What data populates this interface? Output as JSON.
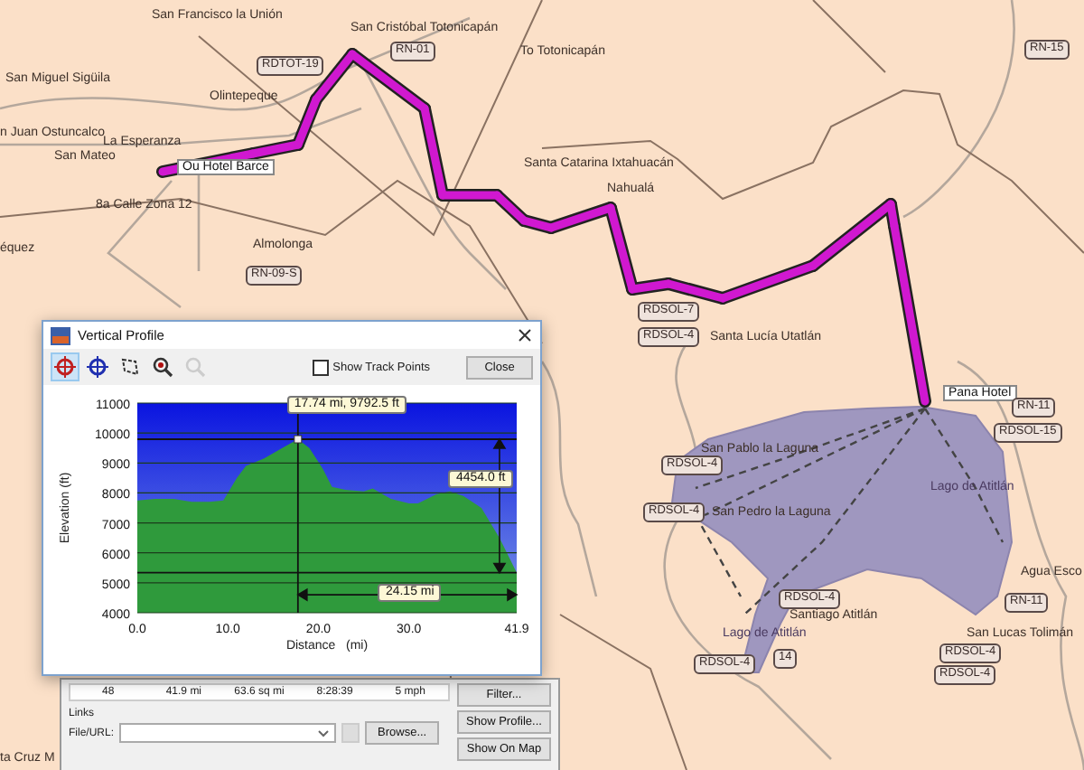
{
  "map": {
    "places": [
      {
        "text": "San Francisco la Unión",
        "kind": "town"
      },
      {
        "text": "San Cristóbal Totonicapán",
        "kind": "town"
      },
      {
        "text": "To Totonicapán",
        "kind": "town"
      },
      {
        "text": "San Miguel Sigüila",
        "kind": "town"
      },
      {
        "text": "Olintepeque",
        "kind": "town"
      },
      {
        "text": "n Juan Ostuncalco",
        "kind": "town"
      },
      {
        "text": "La Esperanza",
        "kind": "town"
      },
      {
        "text": "San Mateo",
        "kind": "town"
      },
      {
        "text": "Ou Hotel Barce",
        "kind": "waypoint"
      },
      {
        "text": "Santa Catarina Ixtahuacán",
        "kind": "town"
      },
      {
        "text": "Nahualá",
        "kind": "town"
      },
      {
        "text": "8a Calle Zona 12",
        "kind": "town"
      },
      {
        "text": "Almolonga",
        "kind": "town"
      },
      {
        "text": "équez",
        "kind": "town"
      },
      {
        "text": "Santa Lucía Utatlán",
        "kind": "town"
      },
      {
        "text": "Pana Hotel",
        "kind": "waypoint"
      },
      {
        "text": "San Pablo la Laguna",
        "kind": "town"
      },
      {
        "text": "Lago de Atitlán",
        "kind": "water"
      },
      {
        "text": "San Pedro la Laguna",
        "kind": "town"
      },
      {
        "text": "Agua Esco",
        "kind": "town"
      },
      {
        "text": "Santiago Atitlán",
        "kind": "town"
      },
      {
        "text": "Lago de Atitlán",
        "kind": "water"
      },
      {
        "text": "San Lucas Tolimán",
        "kind": "town"
      },
      {
        "text": "ta Cruz M",
        "kind": "town"
      }
    ],
    "shields": [
      "RDTOT-19",
      "RN-01",
      "RN-09-S",
      "RN-15",
      "RDSOL-7",
      "RDSOL-4",
      "RN-11",
      "RDSOL-15",
      "RDSOL-4",
      "RDSOL-4",
      "RDSOL-4",
      "RDSOL-4",
      "14",
      "RDSOL-4",
      "RDSOL-4",
      "RN-11"
    ]
  },
  "dialog": {
    "title": "Vertical Profile",
    "tools": [
      {
        "kind": "crosshair-red",
        "selected": true,
        "disabled": false
      },
      {
        "kind": "crosshair-blue",
        "selected": false,
        "disabled": false
      },
      {
        "kind": "lasso",
        "selected": false,
        "disabled": false
      },
      {
        "kind": "zoom-in",
        "selected": false,
        "disabled": false
      },
      {
        "kind": "zoom-out",
        "selected": false,
        "disabled": true
      }
    ],
    "show_track_points": {
      "label": "Show Track Points",
      "checked": false
    },
    "close_button": "Close",
    "chart_data": {
      "type": "area",
      "xlabel": "Distance   (mi)",
      "ylabel": "Elevation (ft)",
      "grid": true,
      "x": [
        0,
        2,
        4,
        6,
        8,
        9.5,
        11,
        12,
        14,
        16,
        17.74,
        19,
        20.5,
        21.5,
        23,
        25,
        26,
        28,
        30,
        31,
        33,
        34.5,
        36,
        38,
        40,
        41.9
      ],
      "series": [
        {
          "color": "#2f9a3c",
          "values": [
            7750,
            7800,
            7800,
            7700,
            7700,
            7750,
            8500,
            8900,
            9150,
            9500,
            9792.5,
            9500,
            8800,
            8200,
            8100,
            8050,
            8150,
            7800,
            7650,
            7650,
            7950,
            8050,
            7900,
            7500,
            6500,
            5338
          ]
        }
      ],
      "xlim": [
        0,
        41.9
      ],
      "ylim": [
        4000,
        11000
      ],
      "xticks": [
        {
          "value": 0,
          "label": "0.0"
        },
        {
          "value": 10,
          "label": "10.0"
        },
        {
          "value": 20,
          "label": "20.0"
        },
        {
          "value": 30,
          "label": "30.0"
        },
        {
          "value": 41.9,
          "label": "41.9"
        }
      ],
      "yticks": [
        4000,
        5000,
        6000,
        7000,
        8000,
        9000,
        10000,
        11000
      ],
      "ref_lines": [
        {
          "axis": "x",
          "value": 17.74
        },
        {
          "axis": "y",
          "value": 9792.5
        },
        {
          "axis": "y",
          "value": 5338
        }
      ],
      "annotations": [
        {
          "text": "17.74 mi, 9792.5 ft",
          "x": 17.74,
          "y": 9792.5
        },
        "4454.0 ft",
        "24.15 mi"
      ]
    }
  },
  "properties": {
    "stats": [
      "48",
      "41.9 mi",
      "63.6 sq mi",
      "8:28:39",
      "5 mph"
    ],
    "links_label": "Links",
    "file_label": "File/URL:",
    "browse_button": "Browse...",
    "buttons": [
      "Filter...",
      "Show Profile...",
      "Show On Map"
    ]
  }
}
